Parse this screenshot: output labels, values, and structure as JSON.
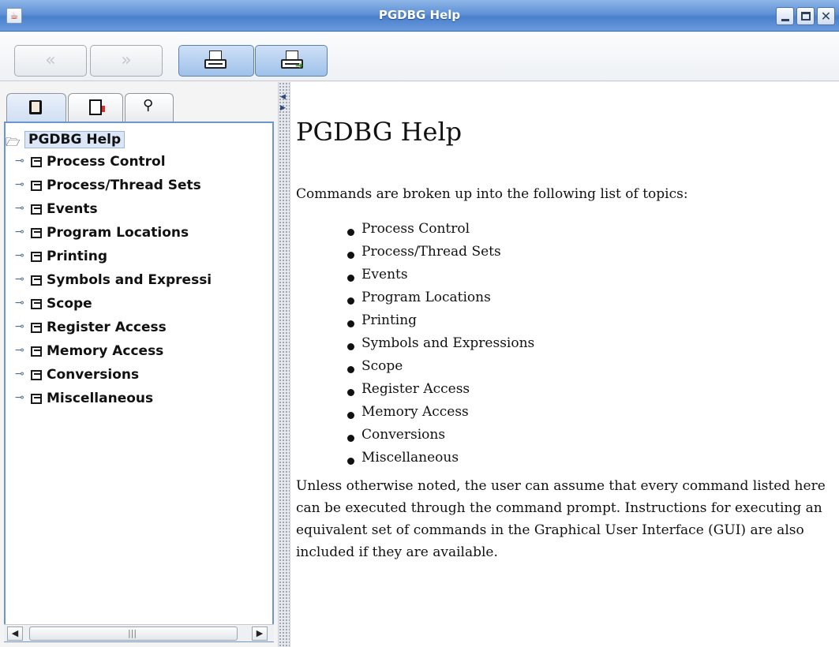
{
  "window": {
    "title": "PGDBG Help",
    "app_icon": "java-cup-icon",
    "controls": [
      "minimize-icon",
      "maximize-icon",
      "close-icon"
    ]
  },
  "toolbar": {
    "back_glyph": "«",
    "forward_glyph": "»",
    "buttons": [
      "back-button",
      "forward-button",
      "print-button",
      "print-setup-button"
    ]
  },
  "navigator": {
    "tabs": [
      "toc-tab",
      "index-tab",
      "search-tab"
    ],
    "tree": {
      "root": "PGDBG Help",
      "children": [
        "Process Control",
        "Process/Thread Sets",
        "Events",
        "Program Locations",
        "Printing",
        "Symbols and Expressi",
        "Scope",
        "Register Access",
        "Memory Access",
        "Conversions",
        "Miscellaneous"
      ]
    },
    "scrollbar": {
      "thumb_grip": "|||"
    }
  },
  "content": {
    "heading": "PGDBG Help",
    "intro": "Commands are broken up into the following list of topics:",
    "topics": [
      "Process Control",
      "Process/Thread Sets",
      "Events",
      "Program Locations",
      "Printing",
      "Symbols and Expressions",
      "Scope",
      "Register Access",
      "Memory Access",
      "Conversions",
      "Miscellaneous"
    ],
    "outro": "Unless otherwise noted, the user can assume that every command listed here can be executed through the command prompt. Instructions for executing an equivalent set of commands in the Graphical User Interface (GUI) are also included if they are available."
  },
  "colors": {
    "titlebar": "#5f92d6",
    "selection": "#dbe6f6",
    "tree_border": "#6d95cf"
  }
}
